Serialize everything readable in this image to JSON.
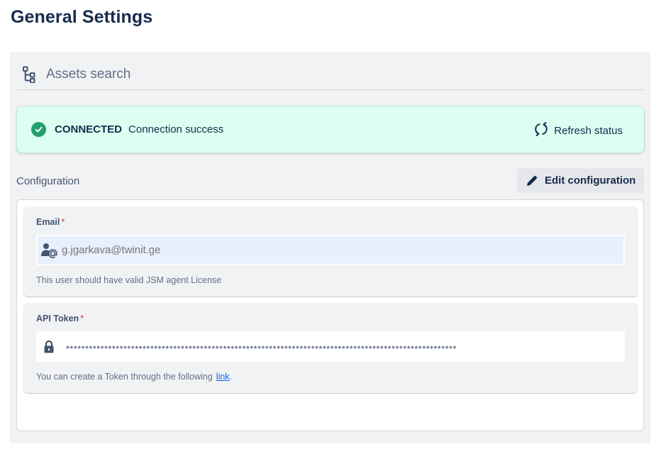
{
  "page": {
    "title": "General Settings"
  },
  "section": {
    "title": "Assets search",
    "icon": "hierarchy-icon"
  },
  "status": {
    "label": "CONNECTED",
    "message": "Connection success",
    "refresh_label": "Refresh status",
    "color": "#22a06b",
    "background": "#dcfff1"
  },
  "configuration": {
    "label": "Configuration",
    "edit_label": "Edit configuration"
  },
  "fields": {
    "email": {
      "label": "Email",
      "required_mark": "*",
      "placeholder": "g.jgarkava@twinit.ge",
      "helper": "This user should have valid JSM agent License"
    },
    "api_token": {
      "label": "API Token",
      "required_mark": "*",
      "masked_value": "••••••••••••••••••••••••••••••••••••••••••••••••••••••••••••••••••••••••••••••••••••••••••••••••••••••",
      "helper": "You can create a Token through the following",
      "link_text": "link",
      "helper_suffix": "."
    }
  }
}
